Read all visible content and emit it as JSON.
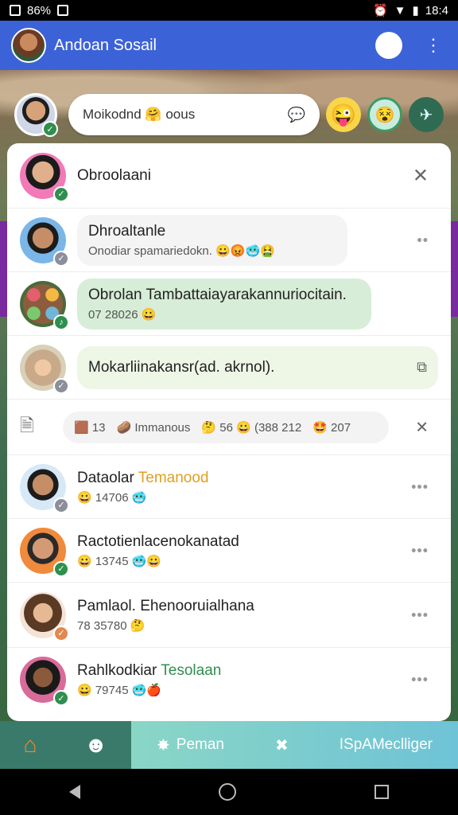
{
  "status_bar": {
    "left_text": "86%",
    "time": "18:4"
  },
  "app_bar": {
    "title": "Andoan Sosail",
    "face_icon": "face-icon",
    "more_icon": "more-vert-icon"
  },
  "compose": {
    "placeholder_text": "Moikodnd 🤗 oous",
    "emoji1": "😜",
    "emoji2": "😵",
    "emoji3": "✈"
  },
  "chat": {
    "header": {
      "name": "Obroolaani"
    },
    "items": [
      {
        "name": "Dhroaltanle",
        "sub": "Onodiar spamariedokn. 😀😡🥶🤮"
      },
      {
        "name": "Obrolan Tambattaiayarakannuriocitain.",
        "sub": "07 28026 😀"
      },
      {
        "name": "Mokarliinakansr(ad. akrnol).",
        "sub": ""
      }
    ],
    "stats": {
      "s1": "🟫 13",
      "s2": "🥔 Immanous",
      "s3": "🤔 56 😀 (388 212",
      "s4": "🤩 207"
    },
    "contacts": [
      {
        "name_a": "Dataolar ",
        "name_b": "Temanood",
        "sub": "😀 14706 🥶"
      },
      {
        "name_a": "Ractotienlacenokanatad",
        "name_b": "",
        "sub": "😀 13745 🥶😀"
      },
      {
        "name_a": "Pamlaol. Ehenooruialhana",
        "name_b": "",
        "sub": "78 35780 🤔"
      },
      {
        "name_a": "Rahlkodkiar ",
        "name_b": "Tesolaan",
        "sub": "😀 79745 🥶🍎"
      }
    ]
  },
  "bottom_nav": {
    "item3": "Peman",
    "item5": "ISpAMeclliger"
  },
  "colors": {
    "appbar": "#3c62d8",
    "accent_green": "#2f8f4e"
  }
}
